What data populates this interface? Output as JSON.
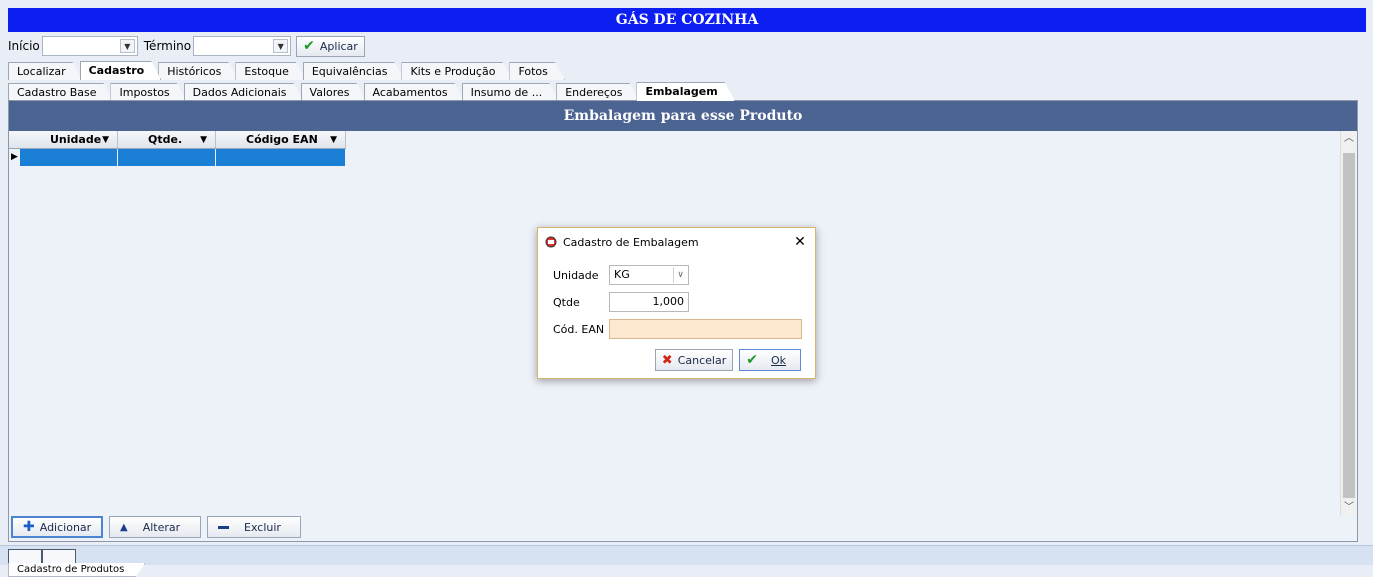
{
  "title_bar": {
    "title": "GÁS DE COZINHA"
  },
  "filters": {
    "inicio_label": "Início",
    "inicio_value": "",
    "termino_label": "Término",
    "termino_value": "",
    "apply_label": "Aplicar"
  },
  "main_tabs": [
    {
      "label": "Localizar",
      "active": false
    },
    {
      "label": "Cadastro",
      "active": true
    },
    {
      "label": "Históricos",
      "active": false
    },
    {
      "label": "Estoque",
      "active": false
    },
    {
      "label": "Equivalências",
      "active": false
    },
    {
      "label": "Kits e Produção",
      "active": false
    },
    {
      "label": "Fotos",
      "active": false
    }
  ],
  "sub_tabs": [
    {
      "label": "Cadastro Base",
      "active": false
    },
    {
      "label": "Impostos",
      "active": false
    },
    {
      "label": "Dados Adicionais",
      "active": false
    },
    {
      "label": "Valores",
      "active": false
    },
    {
      "label": "Acabamentos",
      "active": false
    },
    {
      "label": "Insumo de ...",
      "active": false
    },
    {
      "label": "Endereços",
      "active": false
    },
    {
      "label": "Embalagem",
      "active": true
    }
  ],
  "panel": {
    "header": "Embalagem para esse Produto",
    "columns": [
      "Unidade",
      "Qtde.",
      "Código EAN"
    ],
    "rows": [
      [
        "",
        "",
        ""
      ]
    ]
  },
  "actions": {
    "add": "Adicionar",
    "edit": "Alterar",
    "delete": "Excluir"
  },
  "status": {
    "bottom_tab": "Cadastro de Produtos"
  },
  "dialog": {
    "title": "Cadastro de Embalagem",
    "unidade_label": "Unidade",
    "unidade_value": "KG",
    "qtde_label": "Qtde",
    "qtde_value": "1,000",
    "ean_label": "Cód. EAN",
    "ean_value": "",
    "cancel_label": "Cancelar",
    "ok_label": "Ok"
  },
  "colors": {
    "title_bar": "#0d1ef2",
    "panel_header": "#4b6491",
    "selected_row": "#1c7fd6",
    "ean_field": "#fde7cf"
  }
}
